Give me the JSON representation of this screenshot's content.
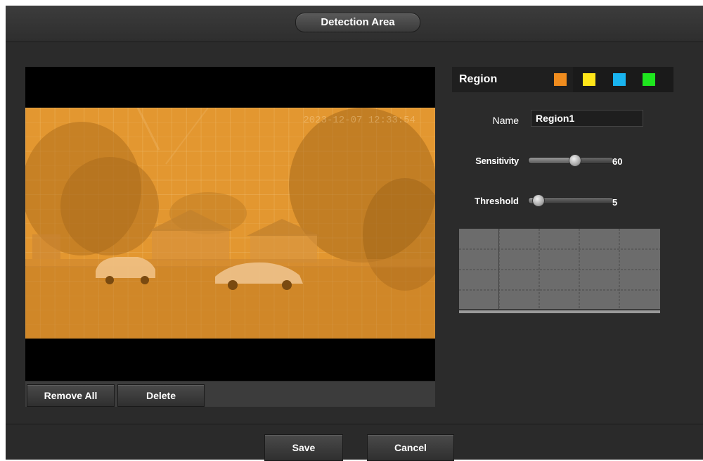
{
  "window": {
    "title": "Detection Area"
  },
  "video": {
    "timestamp": "2023-12-07 12:33:54",
    "buttons": {
      "remove_all": "Remove All",
      "delete": "Delete"
    }
  },
  "region": {
    "label": "Region",
    "colors": [
      {
        "name": "orange",
        "hex": "#f08c1e",
        "selected": true
      },
      {
        "name": "yellow",
        "hex": "#ffe619"
      },
      {
        "name": "cyan",
        "hex": "#19b4f0"
      },
      {
        "name": "green",
        "hex": "#1ee61e"
      }
    ]
  },
  "form": {
    "name_label": "Name",
    "name_value": "Region1",
    "sensitivity_label": "Sensitivity",
    "sensitivity_value": "60",
    "threshold_label": "Threshold",
    "threshold_value": "5"
  },
  "footer": {
    "save": "Save",
    "cancel": "Cancel"
  }
}
